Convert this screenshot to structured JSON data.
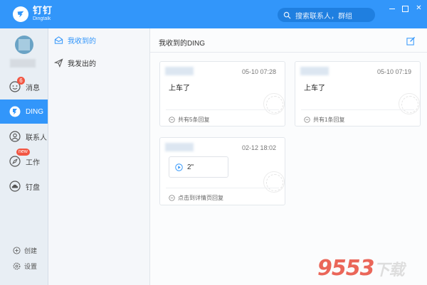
{
  "app": {
    "name_cn": "钉钉",
    "name_en": "Dingtalk"
  },
  "search": {
    "placeholder": "搜索联系人，群组"
  },
  "colors": {
    "accent": "#3296fa",
    "badge": "#f25643"
  },
  "nav": {
    "items": [
      {
        "label": "消息",
        "icon": "chat-icon",
        "badge": "6"
      },
      {
        "label": "DING",
        "icon": "ding-icon"
      },
      {
        "label": "联系人",
        "icon": "contacts-icon"
      },
      {
        "label": "工作",
        "icon": "compass-icon",
        "badge": "new"
      },
      {
        "label": "钉盘",
        "icon": "cloud-drive-icon"
      }
    ],
    "bottom": [
      {
        "label": "创建",
        "icon": "plus-circle-icon"
      },
      {
        "label": "设置",
        "icon": "gear-icon"
      }
    ]
  },
  "subnav": {
    "items": [
      {
        "label": "我收到的",
        "icon": "inbox-icon",
        "active": true
      },
      {
        "label": "我发出的",
        "icon": "send-icon",
        "active": false
      }
    ]
  },
  "main": {
    "title": "我收到的DING",
    "cards": [
      {
        "time": "05-10 07:28",
        "text": "上车了",
        "reply": "共有5条回复"
      },
      {
        "time": "05-10 07:19",
        "text": "上车了",
        "reply": "共有1条回复"
      },
      {
        "time": "02-12 18:02",
        "voice": "2\"",
        "reply": "点击到详情页回复"
      }
    ]
  },
  "watermark": {
    "text": "9553",
    "suffix": "下载"
  }
}
